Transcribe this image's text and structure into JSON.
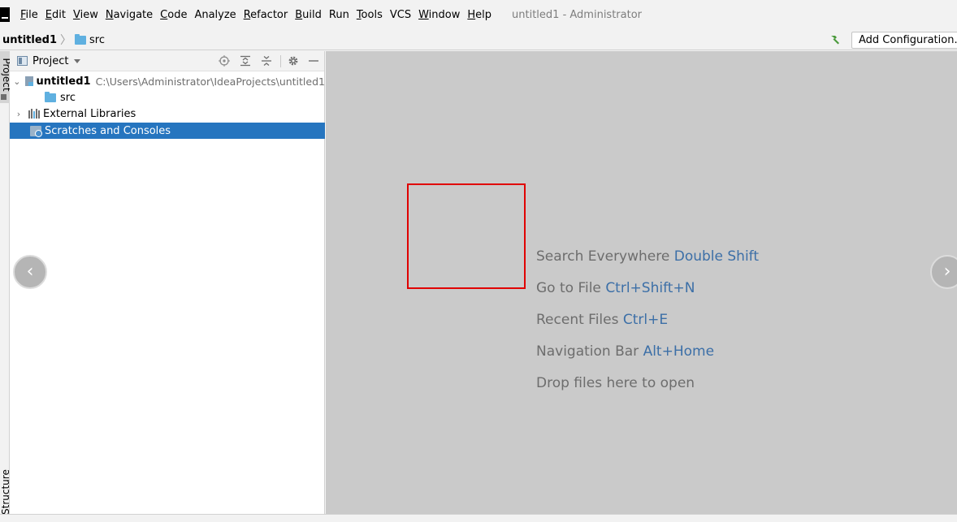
{
  "menubar": {
    "items": [
      {
        "label": "File",
        "mnemonic": "F",
        "rest": "ile"
      },
      {
        "label": "Edit",
        "mnemonic": "E",
        "rest": "dit"
      },
      {
        "label": "View",
        "mnemonic": "V",
        "rest": "iew"
      },
      {
        "label": "Navigate",
        "mnemonic": "N",
        "rest": "avigate"
      },
      {
        "label": "Code",
        "mnemonic": "C",
        "rest": "ode"
      },
      {
        "label": "Analyze",
        "mnemonic": "",
        "rest": "Analyze"
      },
      {
        "label": "Refactor",
        "mnemonic": "R",
        "rest": "efactor"
      },
      {
        "label": "Build",
        "mnemonic": "B",
        "rest": "uild"
      },
      {
        "label": "Run",
        "mnemonic": "",
        "rest": "Run"
      },
      {
        "label": "Tools",
        "mnemonic": "T",
        "rest": "ools"
      },
      {
        "label": "VCS",
        "mnemonic": "",
        "rest": "VCS"
      },
      {
        "label": "Window",
        "mnemonic": "W",
        "rest": "indow"
      },
      {
        "label": "Help",
        "mnemonic": "H",
        "rest": "elp"
      }
    ],
    "window_title": "untitled1 - Administrator"
  },
  "navbar": {
    "project": "untitled1",
    "separator": "〉",
    "folder": "src",
    "add_configuration": "Add Configuration..."
  },
  "left_strip": {
    "project_tab": "Project",
    "structure_tab": "Structure"
  },
  "project_panel": {
    "title": "Project",
    "tree": [
      {
        "name": "untitled1",
        "path": "C:\\Users\\Administrator\\IdeaProjects\\untitled1",
        "expanded": true
      },
      {
        "name": "src"
      },
      {
        "name": "External Libraries",
        "expanded": false
      },
      {
        "name": "Scratches and Consoles",
        "selected": true
      }
    ]
  },
  "editor": {
    "hints": [
      {
        "text": "Search Everywhere",
        "key": "Double Shift"
      },
      {
        "text": "Go to File",
        "key": "Ctrl+Shift+N"
      },
      {
        "text": "Recent Files",
        "key": "Ctrl+E"
      },
      {
        "text": "Navigation Bar",
        "key": "Alt+Home"
      },
      {
        "text": "Drop files here to open",
        "key": ""
      }
    ],
    "prev_arrow": "‹",
    "next_arrow": "›"
  },
  "colors": {
    "selection": "#2675bf",
    "shortcut": "#3c6fa7",
    "highlight_box": "#e00000",
    "editor_bg": "#cacaca"
  }
}
